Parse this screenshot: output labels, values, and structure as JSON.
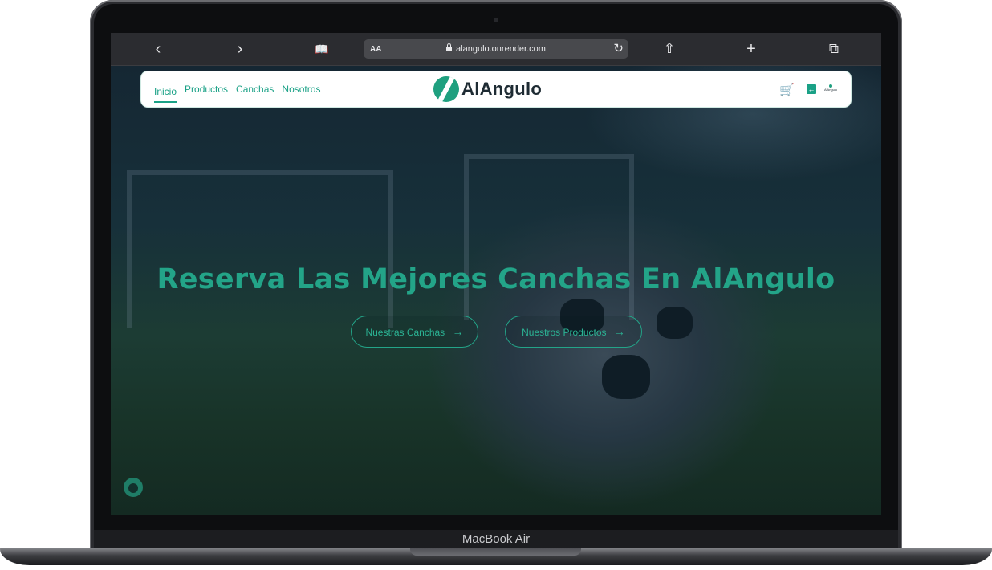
{
  "device": {
    "label": "MacBook Air"
  },
  "browser": {
    "back_icon": "chevron-left-icon",
    "forward_icon": "chevron-right-icon",
    "reader_label": "AA",
    "url": "alangulo.onrender.com",
    "back_glyph": "‹",
    "forward_glyph": "›",
    "book_glyph": "📖",
    "reload_glyph": "↻",
    "share_glyph": "⇧",
    "plus_glyph": "+",
    "tabs_glyph": "⧉"
  },
  "navbar": {
    "links": [
      "Inicio",
      "Productos",
      "Canchas",
      "Nosotros"
    ],
    "active_link": "Inicio",
    "brand": "AlAngulo",
    "cart_glyph": "🛒",
    "logout_glyph": "←",
    "mini_logo_text": "AlAngulo"
  },
  "hero": {
    "headline": "Reserva Las Mejores Canchas En AlAngulo",
    "buttons": [
      {
        "label": "Nuestras Canchas",
        "arrow": "→"
      },
      {
        "label": "Nuestros Productos",
        "arrow": "→"
      }
    ]
  },
  "colors": {
    "accent": "#23a488",
    "nav_bg": "#ffffff",
    "brand_text": "#1e2b33"
  }
}
